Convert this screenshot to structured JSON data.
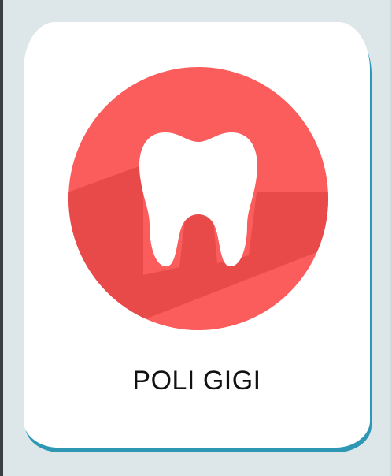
{
  "card": {
    "label": "POLI GIGI",
    "icon": "tooth-icon"
  },
  "colors": {
    "background": "#dde7ea",
    "card": "#ffffff",
    "card_shadow": "#2e98b4",
    "circle": "#fb5c5c",
    "circle_shadow": "#e84a4a",
    "tooth": "#ffffff",
    "label": "#111111"
  }
}
